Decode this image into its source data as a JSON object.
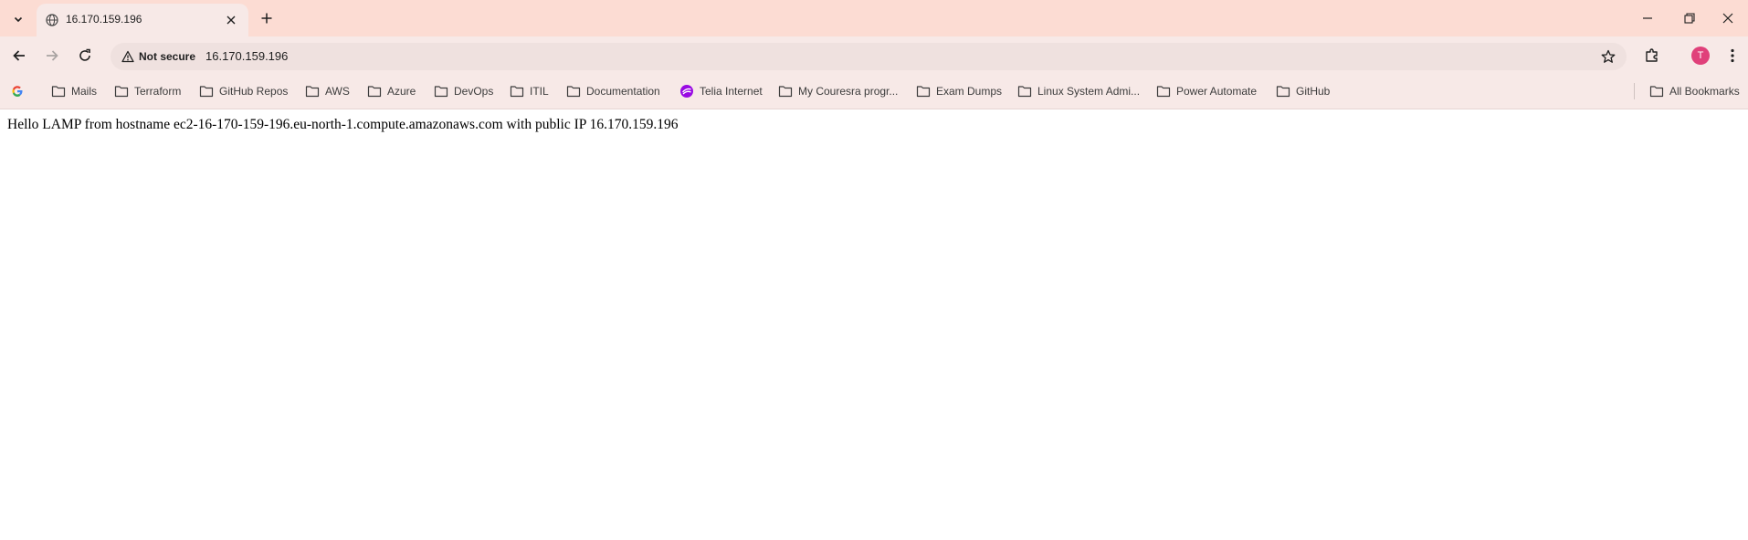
{
  "tab": {
    "title": "16.170.159.196"
  },
  "omnibox": {
    "security_label": "Not secure",
    "url": "16.170.159.196"
  },
  "profile": {
    "initial": "T",
    "color": "#e0407a"
  },
  "bookmarks": [
    {
      "label": "Mails",
      "icon": "folder-icon"
    },
    {
      "label": "Terraform",
      "icon": "folder-icon"
    },
    {
      "label": "GitHub Repos",
      "icon": "folder-icon"
    },
    {
      "label": "AWS",
      "icon": "folder-icon"
    },
    {
      "label": "Azure",
      "icon": "folder-icon"
    },
    {
      "label": "DevOps",
      "icon": "folder-icon"
    },
    {
      "label": "ITIL",
      "icon": "folder-icon"
    },
    {
      "label": "Documentation",
      "icon": "folder-icon"
    },
    {
      "label": "Telia Internet",
      "icon": "telia-icon"
    },
    {
      "label": "My Couresra progr...",
      "icon": "folder-icon"
    },
    {
      "label": "Exam Dumps",
      "icon": "folder-icon"
    },
    {
      "label": "Linux System Admi...",
      "icon": "folder-icon"
    },
    {
      "label": "Power Automate",
      "icon": "folder-icon"
    },
    {
      "label": "GitHub",
      "icon": "folder-icon"
    }
  ],
  "all_bookmarks": {
    "label": "All Bookmarks"
  },
  "page": {
    "text": "Hello LAMP from hostname ec2-16-170-159-196.eu-north-1.compute.amazonaws.com with public IP 16.170.159.196"
  },
  "colors": {
    "titlebar": "#fcdcd3",
    "toolbar": "#f7e9e7",
    "omnibox": "#efe1df",
    "telia": "#990ae3"
  }
}
